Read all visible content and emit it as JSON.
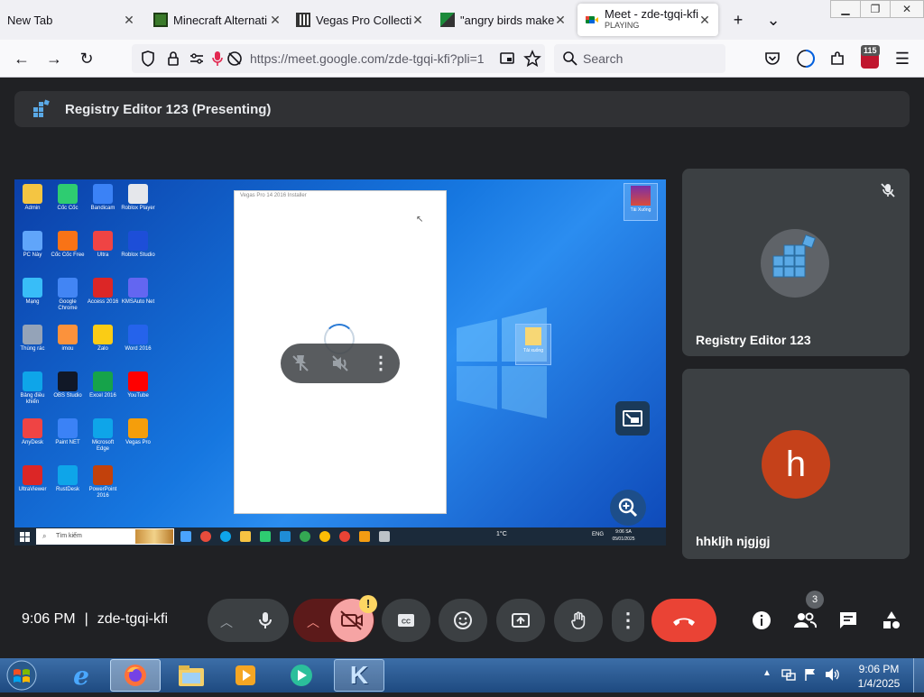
{
  "browser": {
    "tabs": [
      {
        "label": "New Tab",
        "active": false,
        "icon": "none"
      },
      {
        "label": "Minecraft Alternati",
        "active": false,
        "icon": "minecraft-icon"
      },
      {
        "label": "Vegas Pro Collectio",
        "active": false,
        "icon": "vegas-icon"
      },
      {
        "label": "\"angry birds maker",
        "active": false,
        "icon": "pen-icon"
      },
      {
        "label": "Meet - zde-tgqi-kfi",
        "sublabel": "PLAYING",
        "active": true,
        "icon": "meet-icon"
      }
    ],
    "new_tab_glyph": "+",
    "tab_list_glyph": "⌄",
    "url": "https://meet.google.com/zde-tgqi-kfi?pli=1",
    "search_placeholder": "Search",
    "extension_badge": "115"
  },
  "meet": {
    "presenting_title": "Registry Editor 123 (Presenting)",
    "time": "9:06 PM",
    "separator": "|",
    "meeting_code": "zde-tgqi-kfi",
    "people_count": "3",
    "alert_glyph": "!",
    "participants": [
      {
        "name": "Registry Editor 123",
        "avatar": "registry-icon",
        "muted": true
      },
      {
        "name": "hhkljh njgjgj",
        "initial": "h",
        "avatar_color": "#c5411a"
      }
    ],
    "shared_screen": {
      "dialog_title": "Vegas Pro 14 2016 Installer",
      "taskbar_search": "Tìm kiếm",
      "taskbar_time": "9:06 SA",
      "taskbar_date": "05/01/2025",
      "taskbar_temp": "1°C",
      "taskbar_lang": "ENG",
      "desktop_icons": [
        "Admin",
        "Cốc Cốc",
        "Bandicam",
        "Roblox Player",
        "PC Này",
        "Cốc Cốc Free",
        "Ultra",
        "Roblox Studio",
        "Mạng",
        "Google Chrome",
        "Access 2016",
        "KMSAuto Net",
        "Thùng rác",
        "imou",
        "Zalo",
        "Word 2016",
        "Bảng điều khiển",
        "OBS Studio",
        "Excel 2016",
        "YouTube",
        "AnyDesk",
        "Paint NET",
        "Microsoft Edge",
        "Vegas Pro",
        "UltraViewer",
        "RustDesk",
        "PowerPoint 2016"
      ],
      "desktop_file_right": "Tải Xuống",
      "desktop_folder_mid": "Tải xuống"
    }
  },
  "taskbar": {
    "time": "9:06 PM",
    "date": "1/4/2025",
    "brand": "K"
  },
  "colors": {
    "meet_bg": "#202124",
    "end_call": "#ea4335",
    "camera_off_bg": "#f6a4a4"
  }
}
